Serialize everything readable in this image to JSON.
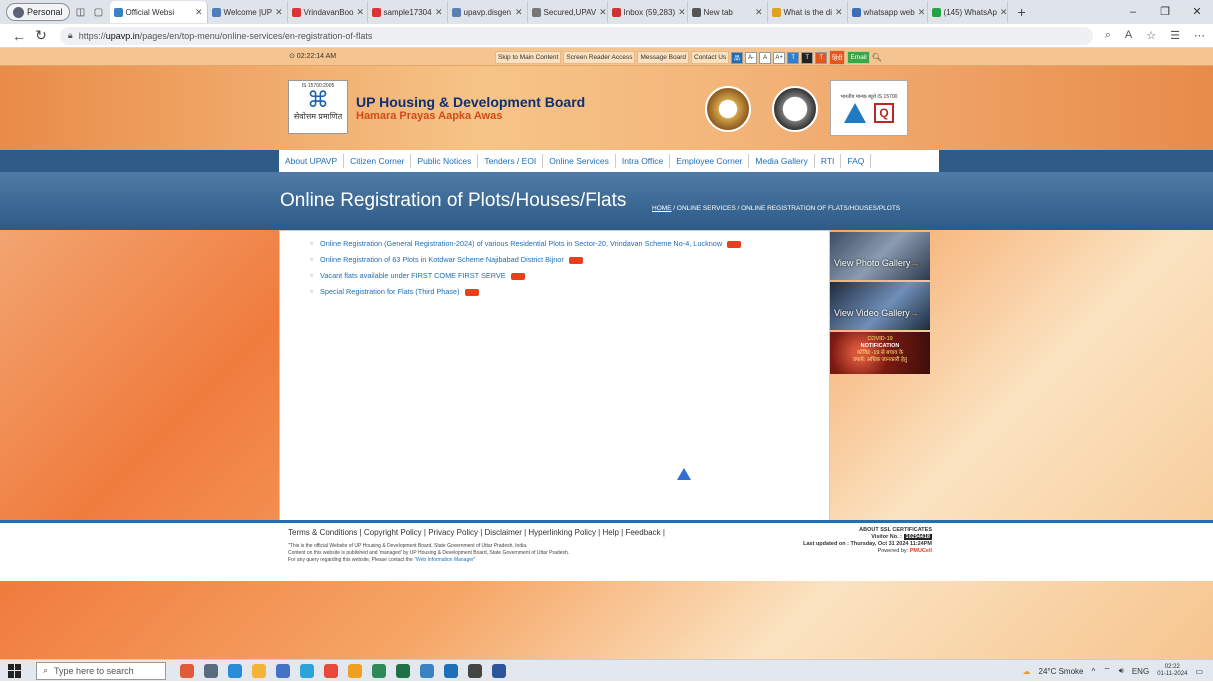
{
  "browser": {
    "profile": "Personal",
    "tabs": [
      {
        "label": "Official Websi",
        "color": "#3b82c4",
        "active": true
      },
      {
        "label": "Welcome |UP",
        "color": "#4c7fbf"
      },
      {
        "label": "VrindavanBoo",
        "color": "#d33"
      },
      {
        "label": "sample17304",
        "color": "#d33"
      },
      {
        "label": "upavp.disgen",
        "color": "#5a7fb5"
      },
      {
        "label": "Secured,UPAV",
        "color": "#777"
      },
      {
        "label": "Inbox (59,283)",
        "color": "#c33"
      },
      {
        "label": "New tab",
        "color": "#555"
      },
      {
        "label": "What is the di",
        "color": "#e0a020"
      },
      {
        "label": "whatsapp web",
        "color": "#3a6fb8"
      },
      {
        "label": "(145) WhatsAp",
        "color": "#25a244"
      }
    ],
    "url_prefix": "https://",
    "url_domain": "upavp.in",
    "url_path": "/pages/en/top-menu/online-services/en-registration-of-flats"
  },
  "topbar": {
    "time": "⊙ 02:22:14 AM",
    "links": [
      "Skip to Main Content",
      "Screen Reader Access",
      "Message Board",
      "Contact Us"
    ],
    "font_buttons": [
      "A-",
      "A",
      "A+"
    ],
    "lang": "हिंदी",
    "email": "Email"
  },
  "header": {
    "iso": "IS 15700:2005",
    "seva": "सेवोत्तम प्रमाणित",
    "title": "UP Housing & Development Board",
    "subtitle": "Hamara Prayas Aapka Awas",
    "cert_hi": "भारतीय मानक ब्यूरो",
    "cert_code": "IS 15700"
  },
  "menu": [
    "About UPAVP",
    "Citizen Corner",
    "Public Notices",
    "Tenders / EOI",
    "Online Services",
    "Intra Office",
    "Employee Corner",
    "Media Gallery",
    "RTI",
    "FAQ"
  ],
  "banner": {
    "title": "Online Registration of Plots/Houses/Flats",
    "crumb_home": "HOME",
    "crumb_rest": " / ONLINE SERVICES / ONLINE REGISTRATION OF FLATS/HOUSES/PLOTS"
  },
  "list": [
    "Online Registration (General Registration-2024) of various Residential Plots in Sector-20, Vrindavan Scheme No-4, Lucknow",
    "Online Registration of 63 Plots in Kotdwar Scheme Najibabad District Bijnor",
    "Vacant flats available under FIRST COME FIRST  SERVE",
    "Special Registration for Flats (Third Phase)"
  ],
  "side": {
    "photo": "View Photo Gallery",
    "video": "View Video Gallery",
    "covid1": "COVID-19",
    "covid2": "NOTIFICATION",
    "covid3": "कोविड -19 से बचाव के",
    "covid4": "उपाये: अधिक जानकारी हेतु"
  },
  "footer": {
    "links": "Terms & Conditions | Copyright Policy | Privacy Policy | Disclaimer | Hyperlinking Policy | Help | Feedback |",
    "l1": "\"This is the official Website of UP Housing & Development Board, State Government of Uttar Pradesh, India.",
    "l2": "Content on this website is published and 'managed' by UP Housing & Development Board, State Government of Uttar Pradesh.",
    "l3": "For any query regarding this website, Please contact the ",
    "l3link": "\"Web Information Manager\"",
    "ssl": "ABOUT SSL CERTIFICATES",
    "visitor_label": "Visitor No. : ",
    "visitor": "10294418",
    "updated": "Last updated on : Thursday, Oct 31 2024 11:24PM",
    "powered": "Powered by: ",
    "pmu": "PMUCell"
  },
  "taskbar": {
    "search": "Type here to search",
    "weather": "24°C  Smoke",
    "lang": "ENG",
    "time": "02:22",
    "date": "01-11-2024"
  }
}
